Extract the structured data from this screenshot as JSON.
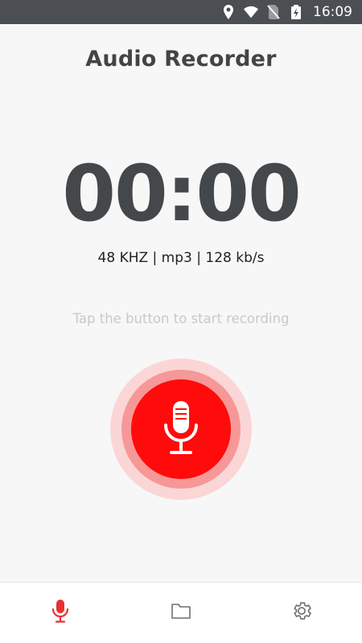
{
  "status_bar": {
    "time": "16:09",
    "icons": [
      "location-icon",
      "wifi-icon",
      "no-sim-icon",
      "battery-charging-icon"
    ]
  },
  "app": {
    "title": "Audio Recorder"
  },
  "recorder": {
    "timer": "00:00",
    "audio_info": "48 KHZ | mp3 | 128 kb/s",
    "hint": "Tap the button to start recording",
    "button_icon": "microphone-icon"
  },
  "bottom_nav": {
    "items": [
      {
        "icon": "microphone-icon",
        "active": true
      },
      {
        "icon": "folder-icon",
        "active": false
      },
      {
        "icon": "settings-icon",
        "active": false
      }
    ]
  },
  "colors": {
    "accent": "#ff0b0b",
    "status_bar": "#4b4f53",
    "background": "#f7f7f7",
    "inactive_icon": "#6f6f6f"
  }
}
